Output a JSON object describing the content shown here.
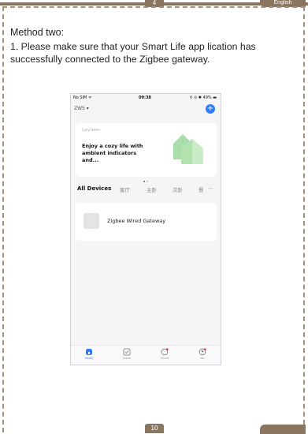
{
  "header": {
    "page_number": "4",
    "language": "English"
  },
  "content": {
    "heading": "Method two:",
    "instruction": "1. Please make sure that your Smart Life app lication has successfully connected to the Zigbee gateway."
  },
  "phone": {
    "status": {
      "carrier": "No SIM",
      "time": "09:38",
      "battery": "49%"
    },
    "home_selector": "ZWS",
    "card": {
      "small_label": "Cozy Home",
      "message": "Enjoy a cozy life with ambient indicators and..."
    },
    "tabs": [
      {
        "label": "All Devices"
      },
      {
        "label": "客厅"
      },
      {
        "label": "主卧"
      },
      {
        "label": "次卧"
      },
      {
        "label": "餐"
      }
    ],
    "more_glyph": "···",
    "device": {
      "name": "Zigbee Wired Gateway"
    },
    "nav": [
      {
        "label": "Home",
        "icon": "home-icon"
      },
      {
        "label": "Scene",
        "icon": "scene-icon"
      },
      {
        "label": "Smart",
        "icon": "smart-icon"
      },
      {
        "label": "Me",
        "icon": "me-icon"
      }
    ],
    "accent_color": "#2d7cf6",
    "alert_color": "#e53935"
  },
  "footer": {
    "page_number": "10"
  },
  "theme": {
    "brand_brown": "#8a7560"
  }
}
